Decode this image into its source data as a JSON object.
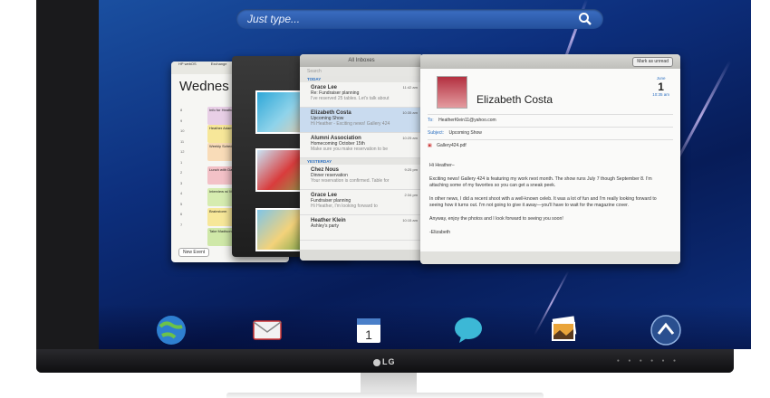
{
  "search": {
    "placeholder": "Just type..."
  },
  "calendar": {
    "tabs": [
      "HP webOS",
      "Exchange"
    ],
    "day_title": "Wednes",
    "hours": [
      "8",
      "9",
      "10",
      "11",
      "12",
      "1",
      "2",
      "3",
      "4",
      "5",
      "6",
      "7"
    ],
    "events": [
      {
        "title": "Info for Heather's new",
        "color": "#e8cfe6"
      },
      {
        "title": "Heather Adams",
        "color": "#f7e799"
      },
      {
        "title": "Weekly Schedule Review",
        "color": "#f9dcb8"
      },
      {
        "title": "Lunch with Dave",
        "color": "#f3c1c7"
      },
      {
        "title": "Interview w/ Mike",
        "color": "#d6ecb0"
      },
      {
        "title": "Brainstorm",
        "color": "#f7e799"
      },
      {
        "title": "Take Madison",
        "color": "#cfe8a8"
      }
    ],
    "new_event_label": "New Event"
  },
  "mail_list": {
    "header": "All Inboxes",
    "search_placeholder": "Search",
    "section_today": "TODAY",
    "section_yesterday": "YESTERDAY",
    "messages": [
      {
        "from": "Grace Lee",
        "subject": "Re: Fundraiser planning",
        "preview": "I've reserved 25 tables. Let's talk about",
        "time": "11:42 am"
      },
      {
        "from": "Elizabeth Costa",
        "subject": "Upcoming Show",
        "preview": "Hi Heather - Exciting news! Gallery 424",
        "time": "10:35 am"
      },
      {
        "from": "Alumni Association",
        "subject": "Homecoming October 15th",
        "preview": "Make sure you make reservation to be",
        "time": "10:25 am"
      },
      {
        "from": "Chez Nous",
        "subject": "Dinner reservation",
        "preview": "Your reservation is confirmed. Table for",
        "time": "9:25 pm"
      },
      {
        "from": "Grace Lee",
        "subject": "Fundraiser planning",
        "preview": "Hi Heather, I'm looking forward to",
        "time": "2:34 pm"
      },
      {
        "from": "Heather Klein",
        "subject": "Ashley's party",
        "preview": "",
        "time": "10:15 am"
      }
    ]
  },
  "email": {
    "mark_label": "Mark as unread",
    "sender_name": "Elizabeth Costa",
    "date_month": "June",
    "date_day": "1",
    "date_time": "10:35 am",
    "to_label": "To:",
    "to_value": "HeatherKlein11@yahoo.com",
    "subject_label": "Subject:",
    "subject_value": "Upcoming Show",
    "attachment": "Gallery424.pdf",
    "body": [
      "Hi Heather–",
      "Exciting news! Gallery 424 is featuring my work next month. The show runs July 7 though September 8. I'm attaching some of my favorites so you can get a sneak peek.",
      "In other news, I did a recent shoot with a well-known celeb. It was a lot of fun and I'm really looking forward to seeing how it turns out. I'm not going to give it away—you'll have to wait for the magazine cover.",
      "Anyway, enjoy the photos and I look forward to seeing you soon!",
      "-Elizabeth"
    ]
  },
  "monitor": {
    "brand": "LG"
  }
}
